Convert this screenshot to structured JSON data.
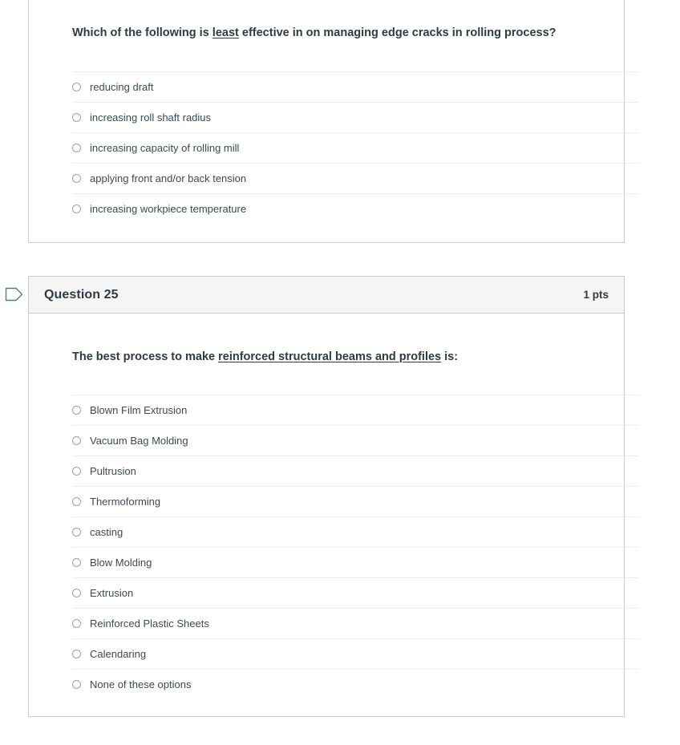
{
  "page": {
    "background_color": "#ffffff",
    "card_border_color": "#c7cdd1",
    "header_background_color": "#f5f5f5",
    "text_color": "#2d3b45",
    "marker_color": "#4c7c9b"
  },
  "questions": [
    {
      "header_visible": false,
      "name": "",
      "points": "",
      "prompt_prefix": "Which of the following is ",
      "prompt_underlined": "least",
      "prompt_suffix": " effective in on managing edge cracks in rolling process?",
      "options": [
        {
          "label": "reducing draft",
          "selected": false
        },
        {
          "label": "increasing roll shaft radius",
          "selected": false
        },
        {
          "label": "increasing capacity of rolling mill",
          "selected": false
        },
        {
          "label": "applying front and/or back tension",
          "selected": false
        },
        {
          "label": "increasing workpiece temperature",
          "selected": false
        }
      ]
    },
    {
      "header_visible": true,
      "name": "Question 25",
      "points": "1 pts",
      "marker_icon": "flag-pointer-icon",
      "prompt_prefix": "The best process to make ",
      "prompt_underlined": "reinforced structural beams and profiles",
      "prompt_suffix": " is:",
      "options": [
        {
          "label": "Blown Film Extrusion",
          "selected": false
        },
        {
          "label": "Vacuum Bag Molding",
          "selected": false
        },
        {
          "label": "Pultrusion",
          "selected": false
        },
        {
          "label": "Thermoforming",
          "selected": false
        },
        {
          "label": "casting",
          "selected": false
        },
        {
          "label": "Blow Molding",
          "selected": false
        },
        {
          "label": "Extrusion",
          "selected": false
        },
        {
          "label": "Reinforced Plastic Sheets",
          "selected": false
        },
        {
          "label": "Calendaring",
          "selected": false
        },
        {
          "label": "None of these options",
          "selected": false
        }
      ]
    }
  ]
}
